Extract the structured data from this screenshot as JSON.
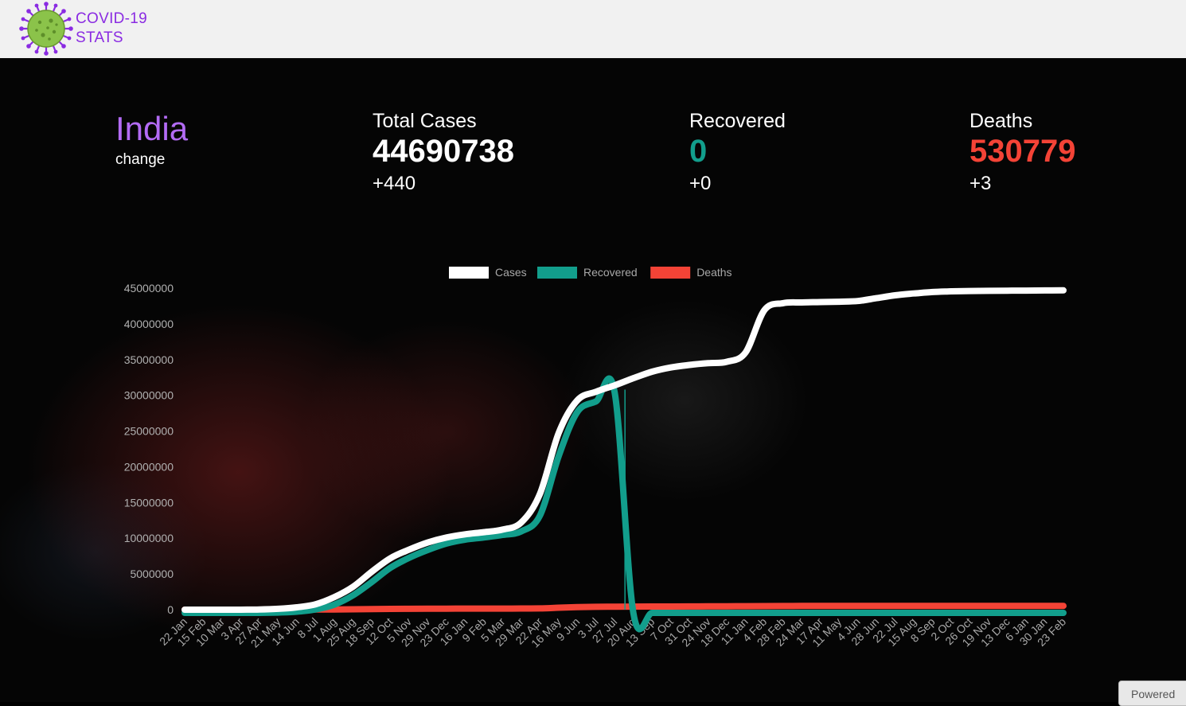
{
  "header": {
    "logo_line1": "COVID-19",
    "logo_line2": "STATS",
    "brand_color": "#8a2be2"
  },
  "country": {
    "name": "India",
    "change_label": "change"
  },
  "stats": {
    "total_cases": {
      "label": "Total Cases",
      "value": "44690738",
      "delta": "+440",
      "color": "#ffffff"
    },
    "recovered": {
      "label": "Recovered",
      "value": "0",
      "delta": "+0",
      "color": "#129e8c"
    },
    "deaths": {
      "label": "Deaths",
      "value": "530779",
      "delta": "+3",
      "color": "#f44336"
    }
  },
  "footer": {
    "powered_label": "Powered"
  },
  "chart_data": {
    "type": "line",
    "title": "",
    "xlabel": "",
    "ylabel": "",
    "ylim": [
      0,
      45000000
    ],
    "yticks": [
      0,
      5000000,
      10000000,
      15000000,
      20000000,
      25000000,
      30000000,
      35000000,
      40000000,
      45000000
    ],
    "grid": false,
    "legend_position": "top",
    "categories": [
      "22 Jan",
      "15 Feb",
      "10 Mar",
      "3 Apr",
      "27 Apr",
      "21 May",
      "14 Jun",
      "8 Jul",
      "1 Aug",
      "25 Aug",
      "18 Sep",
      "12 Oct",
      "5 Nov",
      "29 Nov",
      "23 Dec",
      "16 Jan",
      "9 Feb",
      "5 Mar",
      "29 Mar",
      "22 Apr",
      "16 May",
      "9 Jun",
      "3 Jul",
      "27 Jul",
      "20 Aug",
      "13 Sep",
      "7 Oct",
      "31 Oct",
      "24 Nov",
      "18 Dec",
      "11 Jan",
      "4 Feb",
      "28 Feb",
      "24 Mar",
      "17 Apr",
      "11 May",
      "4 Jun",
      "28 Jun",
      "22 Jul",
      "15 Aug",
      "8 Sep",
      "2 Oct",
      "26 Oct",
      "19 Nov",
      "13 Dec",
      "6 Jan",
      "30 Jan",
      "23 Feb"
    ],
    "series": [
      {
        "name": "Cases",
        "color": "#ffffff",
        "values": [
          0,
          0,
          0,
          3000,
          30000,
          120000,
          330000,
          760000,
          1750000,
          3200000,
          5300000,
          7200000,
          8400000,
          9400000,
          10100000,
          10550000,
          10850000,
          11200000,
          12200000,
          16200000,
          24700000,
          29300000,
          30500000,
          31400000,
          32400000,
          33300000,
          33900000,
          34250000,
          34500000,
          34700000,
          36000000,
          41900000,
          42900000,
          43000000,
          43050000,
          43100000,
          43200000,
          43600000,
          44000000,
          44250000,
          44450000,
          44550000,
          44600000,
          44620000,
          44640000,
          44660000,
          44680000,
          44690738
        ]
      },
      {
        "name": "Recovered",
        "color": "#129e8c",
        "values": [
          0,
          0,
          0,
          0,
          5000,
          45000,
          170000,
          480000,
          1150000,
          2450000,
          4300000,
          6300000,
          7700000,
          8800000,
          9700000,
          10250000,
          10550000,
          10900000,
          11400000,
          13600000,
          21900000,
          28100000,
          29600000,
          30800000,
          0,
          0,
          0,
          0,
          0,
          0,
          0,
          0,
          0,
          0,
          0,
          0,
          0,
          0,
          0,
          0,
          0,
          0,
          0,
          0,
          0,
          0,
          0,
          0
        ]
      },
      {
        "name": "Deaths",
        "color": "#f44336",
        "values": [
          0,
          0,
          0,
          80,
          900,
          3400,
          9500,
          21000,
          36000,
          58000,
          88000,
          109000,
          124000,
          135000,
          147000,
          153000,
          155000,
          158000,
          162000,
          182000,
          276000,
          360000,
          402000,
          418000,
          431000,
          444000,
          451000,
          456000,
          466000,
          478000,
          485000,
          502000,
          514000,
          521000,
          522000,
          524000,
          525000,
          526000,
          526300,
          527100,
          528000,
          528700,
          529000,
          530500,
          530600,
          530700,
          530750,
          530779
        ]
      }
    ]
  }
}
